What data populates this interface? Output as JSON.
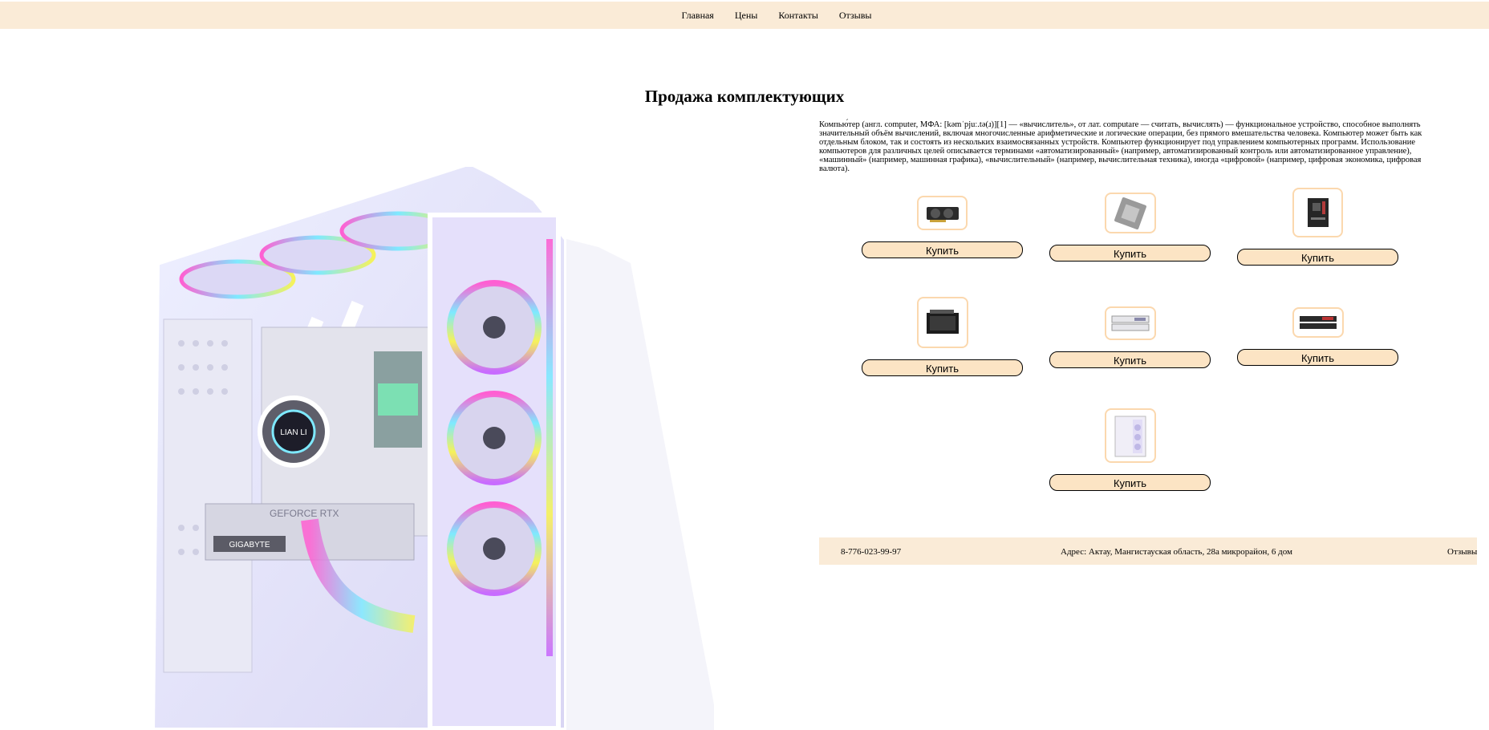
{
  "nav": {
    "items": [
      "Главная",
      "Цены",
      "Контакты",
      "Отзывы"
    ]
  },
  "page": {
    "title": "Продажа комплектующих"
  },
  "intro": "Компью́тер (англ. computer, МФА: [kəmˈpjuː.tə(ɹ)][1] — «вычислитель», от лат. computare — считать, вычислять) — функциональное устройство, способное выполнять значительный объём вычислений, включая многочисленные арифметические и логические операции, без прямого вмешательства человека. Компьютер может быть как отдельным блоком, так и состоять из нескольких взаимосвязанных устройств. Компьютер функционирует под управлением компьютерных программ. Использование компьютеров для различных целей описывается терминами «автоматизированный» (например, автоматизированный контроль или автоматизированное управление), «машинный» (например, машинная графика), «вычислительный» (например, вычислительная техника), иногда «цифровой» (например, цифровая экономика, цифровая валюта).",
  "products": [
    {
      "icon": "graphics-card-icon",
      "buy_label": "Купить"
    },
    {
      "icon": "cpu-icon",
      "buy_label": "Купить"
    },
    {
      "icon": "motherboard-icon",
      "buy_label": "Купить"
    },
    {
      "icon": "power-supply-icon",
      "buy_label": "Купить"
    },
    {
      "icon": "ram-white-icon",
      "buy_label": "Купить"
    },
    {
      "icon": "ram-black-icon",
      "buy_label": "Купить"
    },
    {
      "icon": "pc-case-icon",
      "buy_label": "Купить"
    }
  ],
  "footer": {
    "phone": "8-776-023-99-97",
    "address": "Адрес: Актау, Мангистауская область, 28а микрорайон, 6 дом",
    "reviews": "Отзывы"
  },
  "colors": {
    "bar": "#faebd7",
    "button": "#fce4c4",
    "thumb_border": "#fbd8ae"
  }
}
